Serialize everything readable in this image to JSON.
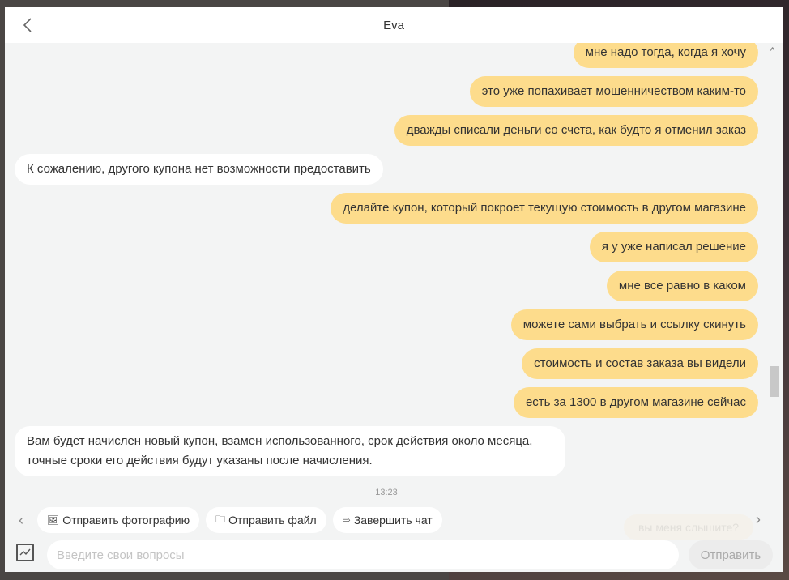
{
  "header": {
    "title": "Eva"
  },
  "messages": [
    {
      "from": "user",
      "text": "мне надо тогда, когда я хочу"
    },
    {
      "from": "user",
      "text": "это уже попахивает мошенничеством каким-то"
    },
    {
      "from": "user",
      "text": "дважды списали деньги со счета, как будто я отменил заказ"
    },
    {
      "from": "bot",
      "text": "К сожалению, другого купона нет возможности предоставить"
    },
    {
      "from": "user",
      "text": "делайте купон, который покроет текущую стоимость в другом магазине"
    },
    {
      "from": "user",
      "text": "я у уже написал решение"
    },
    {
      "from": "user",
      "text": "мне все равно в каком"
    },
    {
      "from": "user",
      "text": "можете сами выбрать и ссылку скинуть"
    },
    {
      "from": "user",
      "text": "стоимость и состав заказа вы видели"
    },
    {
      "from": "user",
      "text": "есть за 1300 в другом магазине сейчас"
    },
    {
      "from": "bot",
      "text": "Вам будет начислен новый купон, взамен использованного, срок действия около месяца, точные сроки его действия будут указаны после начисления."
    }
  ],
  "timestamp": "13:23",
  "quick_actions": [
    {
      "label": "Отправить фотографию",
      "icon": "image-icon"
    },
    {
      "label": "Отправить файл",
      "icon": "folder-icon"
    },
    {
      "label": "Завершить чат",
      "icon": "exit-icon"
    }
  ],
  "ghost_suggestion": "вы меня слышите?",
  "input": {
    "placeholder": "Введите свои вопросы",
    "value": ""
  },
  "send_label": "Отправить",
  "colors": {
    "user_bubble": "#fddc8c",
    "bot_bubble": "#ffffff",
    "background": "#f3f4f4"
  }
}
